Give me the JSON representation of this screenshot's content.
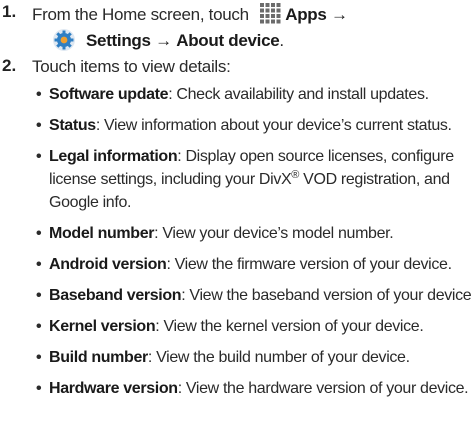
{
  "steps": [
    {
      "number": "1.",
      "line1_prefix": "From the Home screen, touch",
      "apps_label": "Apps",
      "arrow1": "→",
      "settings_label": "Settings",
      "arrow2": "→",
      "about_label": "About device",
      "suffix": ".",
      "icons": [
        "apps-grid-icon",
        "settings-gear-icon"
      ]
    },
    {
      "number": "2.",
      "text": "Touch items to view details:"
    }
  ],
  "items": [
    {
      "term": "Software update",
      "desc": ": Check availability and install updates."
    },
    {
      "term": "Status",
      "desc": ": View information about your device’s current status."
    },
    {
      "term": "Legal information",
      "desc_line1": ": Display open source licenses, configure",
      "desc_line2a": "license settings, including your DivX",
      "reg": "®",
      "desc_line2b": " VOD registration, and",
      "desc_line3": "Google info."
    },
    {
      "term": "Model number",
      "desc": ": View your device’s model number."
    },
    {
      "term": "Android version",
      "desc": ": View the firmware version of your device."
    },
    {
      "term": "Baseband version",
      "desc": ": View the baseband version of your device."
    },
    {
      "term": "Kernel version",
      "desc": ": View the kernel version of your device."
    },
    {
      "term": "Build number",
      "desc": ": View the build number of your device."
    },
    {
      "term": "Hardware version",
      "desc": ": View the hardware version of your device."
    }
  ],
  "colors": {
    "text": "#2a2a2a",
    "gear_blue": "#2f7fc4",
    "gear_orange": "#f0a030",
    "apps_grid": "#6b6b6b"
  }
}
